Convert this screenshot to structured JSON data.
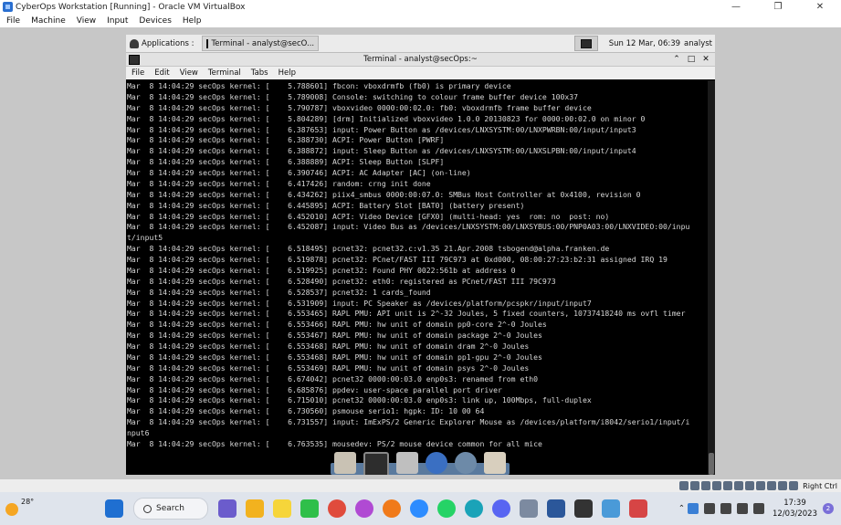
{
  "vbox": {
    "title": "CyberOps Workstation [Running] - Oracle VM VirtualBox",
    "menus": [
      "File",
      "Machine",
      "View",
      "Input",
      "Devices",
      "Help"
    ],
    "host_key": "Right Ctrl"
  },
  "xfce": {
    "applications_label": "Applications :",
    "task_label": "Terminal - analyst@secO...",
    "clock": "Sun 12 Mar, 06:39",
    "user": "analyst"
  },
  "terminal": {
    "title": "Terminal - analyst@secOps:~",
    "menus": [
      "File",
      "Edit",
      "View",
      "Terminal",
      "Tabs",
      "Help"
    ],
    "lines": [
      "Mar  8 14:04:29 secOps kernel: [    5.788601] fbcon: vboxdrmfb (fb0) is primary device",
      "Mar  8 14:04:29 secOps kernel: [    5.789008] Console: switching to colour frame buffer device 100x37",
      "Mar  8 14:04:29 secOps kernel: [    5.790787] vboxvideo 0000:00:02.0: fb0: vboxdrmfb frame buffer device",
      "Mar  8 14:04:29 secOps kernel: [    5.804289] [drm] Initialized vboxvideo 1.0.0 20130823 for 0000:00:02.0 on minor 0",
      "Mar  8 14:04:29 secOps kernel: [    6.387653] input: Power Button as /devices/LNXSYSTM:00/LNXPWRBN:00/input/input3",
      "Mar  8 14:04:29 secOps kernel: [    6.388730] ACPI: Power Button [PWRF]",
      "Mar  8 14:04:29 secOps kernel: [    6.388872] input: Sleep Button as /devices/LNXSYSTM:00/LNXSLPBN:00/input/input4",
      "Mar  8 14:04:29 secOps kernel: [    6.388889] ACPI: Sleep Button [SLPF]",
      "Mar  8 14:04:29 secOps kernel: [    6.390746] ACPI: AC Adapter [AC] (on-line)",
      "Mar  8 14:04:29 secOps kernel: [    6.417426] random: crng init done",
      "Mar  8 14:04:29 secOps kernel: [    6.434262] piix4_smbus 0000:00:07.0: SMBus Host Controller at 0x4100, revision 0",
      "Mar  8 14:04:29 secOps kernel: [    6.445895] ACPI: Battery Slot [BAT0] (battery present)",
      "Mar  8 14:04:29 secOps kernel: [    6.452010] ACPI: Video Device [GFX0] (multi-head: yes  rom: no  post: no)",
      "Mar  8 14:04:29 secOps kernel: [    6.452087] input: Video Bus as /devices/LNXSYSTM:00/LNXSYBUS:00/PNP0A03:00/LNXVIDEO:00/inpu",
      "t/input5",
      "Mar  8 14:04:29 secOps kernel: [    6.518495] pcnet32: pcnet32.c:v1.35 21.Apr.2008 tsbogend@alpha.franken.de",
      "Mar  8 14:04:29 secOps kernel: [    6.519878] pcnet32: PCnet/FAST III 79C973 at 0xd000, 08:00:27:23:b2:31 assigned IRQ 19",
      "Mar  8 14:04:29 secOps kernel: [    6.519925] pcnet32: Found PHY 0022:561b at address 0",
      "Mar  8 14:04:29 secOps kernel: [    6.528490] pcnet32: eth0: registered as PCnet/FAST III 79C973",
      "Mar  8 14:04:29 secOps kernel: [    6.528537] pcnet32: 1 cards_found",
      "Mar  8 14:04:29 secOps kernel: [    6.531909] input: PC Speaker as /devices/platform/pcspkr/input/input7",
      "Mar  8 14:04:29 secOps kernel: [    6.553465] RAPL PMU: API unit is 2^-32 Joules, 5 fixed counters, 10737418240 ms ovfl timer",
      "Mar  8 14:04:29 secOps kernel: [    6.553466] RAPL PMU: hw unit of domain pp0-core 2^-0 Joules",
      "Mar  8 14:04:29 secOps kernel: [    6.553467] RAPL PMU: hw unit of domain package 2^-0 Joules",
      "Mar  8 14:04:29 secOps kernel: [    6.553468] RAPL PMU: hw unit of domain dram 2^-0 Joules",
      "Mar  8 14:04:29 secOps kernel: [    6.553468] RAPL PMU: hw unit of domain pp1-gpu 2^-0 Joules",
      "Mar  8 14:04:29 secOps kernel: [    6.553469] RAPL PMU: hw unit of domain psys 2^-0 Joules",
      "Mar  8 14:04:29 secOps kernel: [    6.674042] pcnet32 0000:00:03.0 enp0s3: renamed from eth0",
      "Mar  8 14:04:29 secOps kernel: [    6.685876] ppdev: user-space parallel port driver",
      "Mar  8 14:04:29 secOps kernel: [    6.715010] pcnet32 0000:00:03.0 enp0s3: link up, 100Mbps, full-duplex",
      "Mar  8 14:04:29 secOps kernel: [    6.730560] psmouse serio1: hgpk: ID: 10 00 64",
      "Mar  8 14:04:29 secOps kernel: [    6.731557] input: ImExPS/2 Generic Explorer Mouse as /devices/platform/i8042/serio1/input/i",
      "nput6",
      "Mar  8 14:04:29 secOps kernel: [    6.763535] mousedev: PS/2 mouse device common for all mice"
    ]
  },
  "windows": {
    "weather_temp": "28°",
    "search_label": "Search",
    "time": "17:39",
    "date": "12/03/2023",
    "notification_count": "2"
  },
  "colors": {
    "terminal_bg": "#000000",
    "terminal_fg": "#d8d8d8",
    "taskbar_bg": "#dfe4ec"
  }
}
